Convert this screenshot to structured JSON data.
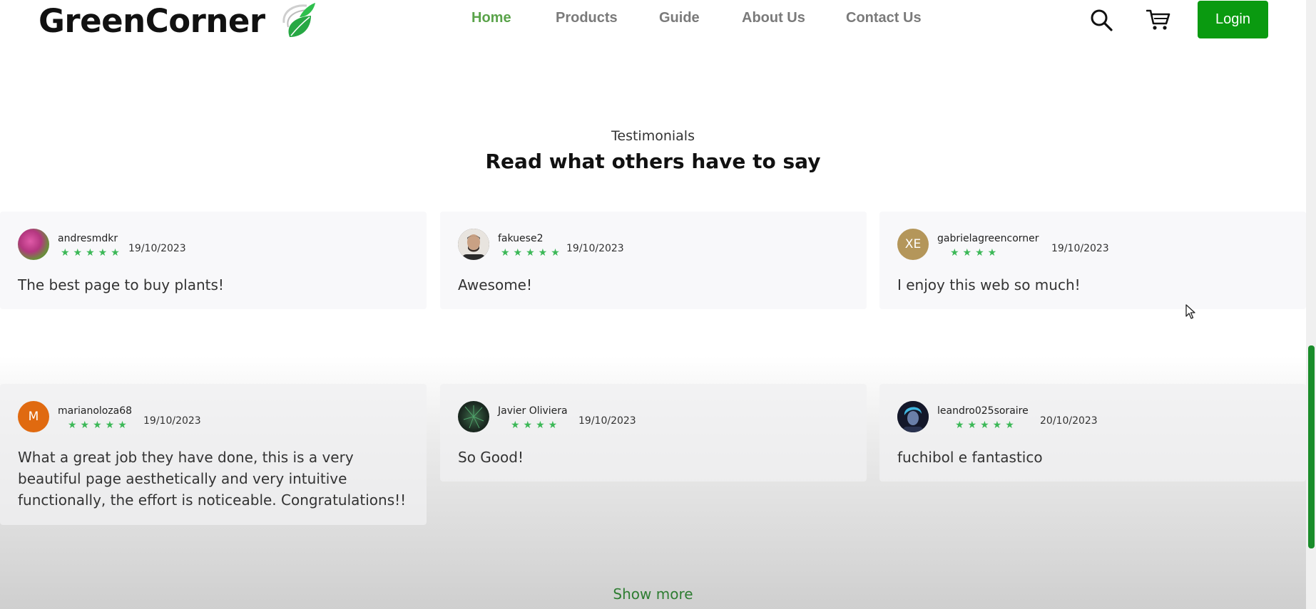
{
  "header": {
    "logo_text": "GreenCorner",
    "nav": [
      {
        "label": "Home",
        "active": true
      },
      {
        "label": "Products"
      },
      {
        "label": "Guide"
      },
      {
        "label": "About Us"
      },
      {
        "label": "Contact Us"
      }
    ],
    "search_icon": "search-icon",
    "cart_icon": "cart-icon",
    "login_label": "Login"
  },
  "section": {
    "eyebrow": "Testimonials",
    "title": "Read what others have to say",
    "show_more": "Show more"
  },
  "testimonials": [
    {
      "username": "andresmdkr",
      "date": "19/10/2023",
      "stars": 5,
      "comment": "The best page to buy plants!",
      "avatar": "photo"
    },
    {
      "username": "fakuese2",
      "date": "19/10/2023",
      "stars": 5,
      "comment": "Awesome!",
      "avatar": "photo"
    },
    {
      "username": "gabrielagreencorner",
      "date": "19/10/2023",
      "stars": 4,
      "comment": "I enjoy this web so much!",
      "avatar": "XE"
    },
    {
      "username": "marianoloza68",
      "date": "19/10/2023",
      "stars": 5,
      "comment": "What a great job they have done, this is a very beautiful page aesthetically and very intuitive functionally, the effort is noticeable. Congratulations!!",
      "avatar": "M"
    },
    {
      "username": "Javier Oliviera",
      "date": "19/10/2023",
      "stars": 4,
      "comment": "So Good!",
      "avatar": "photo"
    },
    {
      "username": "leandro025soraire",
      "date": "20/10/2023",
      "stars": 5,
      "comment": "fuchibol e fantastico",
      "avatar": "photo"
    }
  ],
  "colors": {
    "brand_green": "#0a9a10",
    "nav_active": "#5aa34a",
    "star_green": "#3cb857",
    "show_more": "#2e7d32"
  }
}
